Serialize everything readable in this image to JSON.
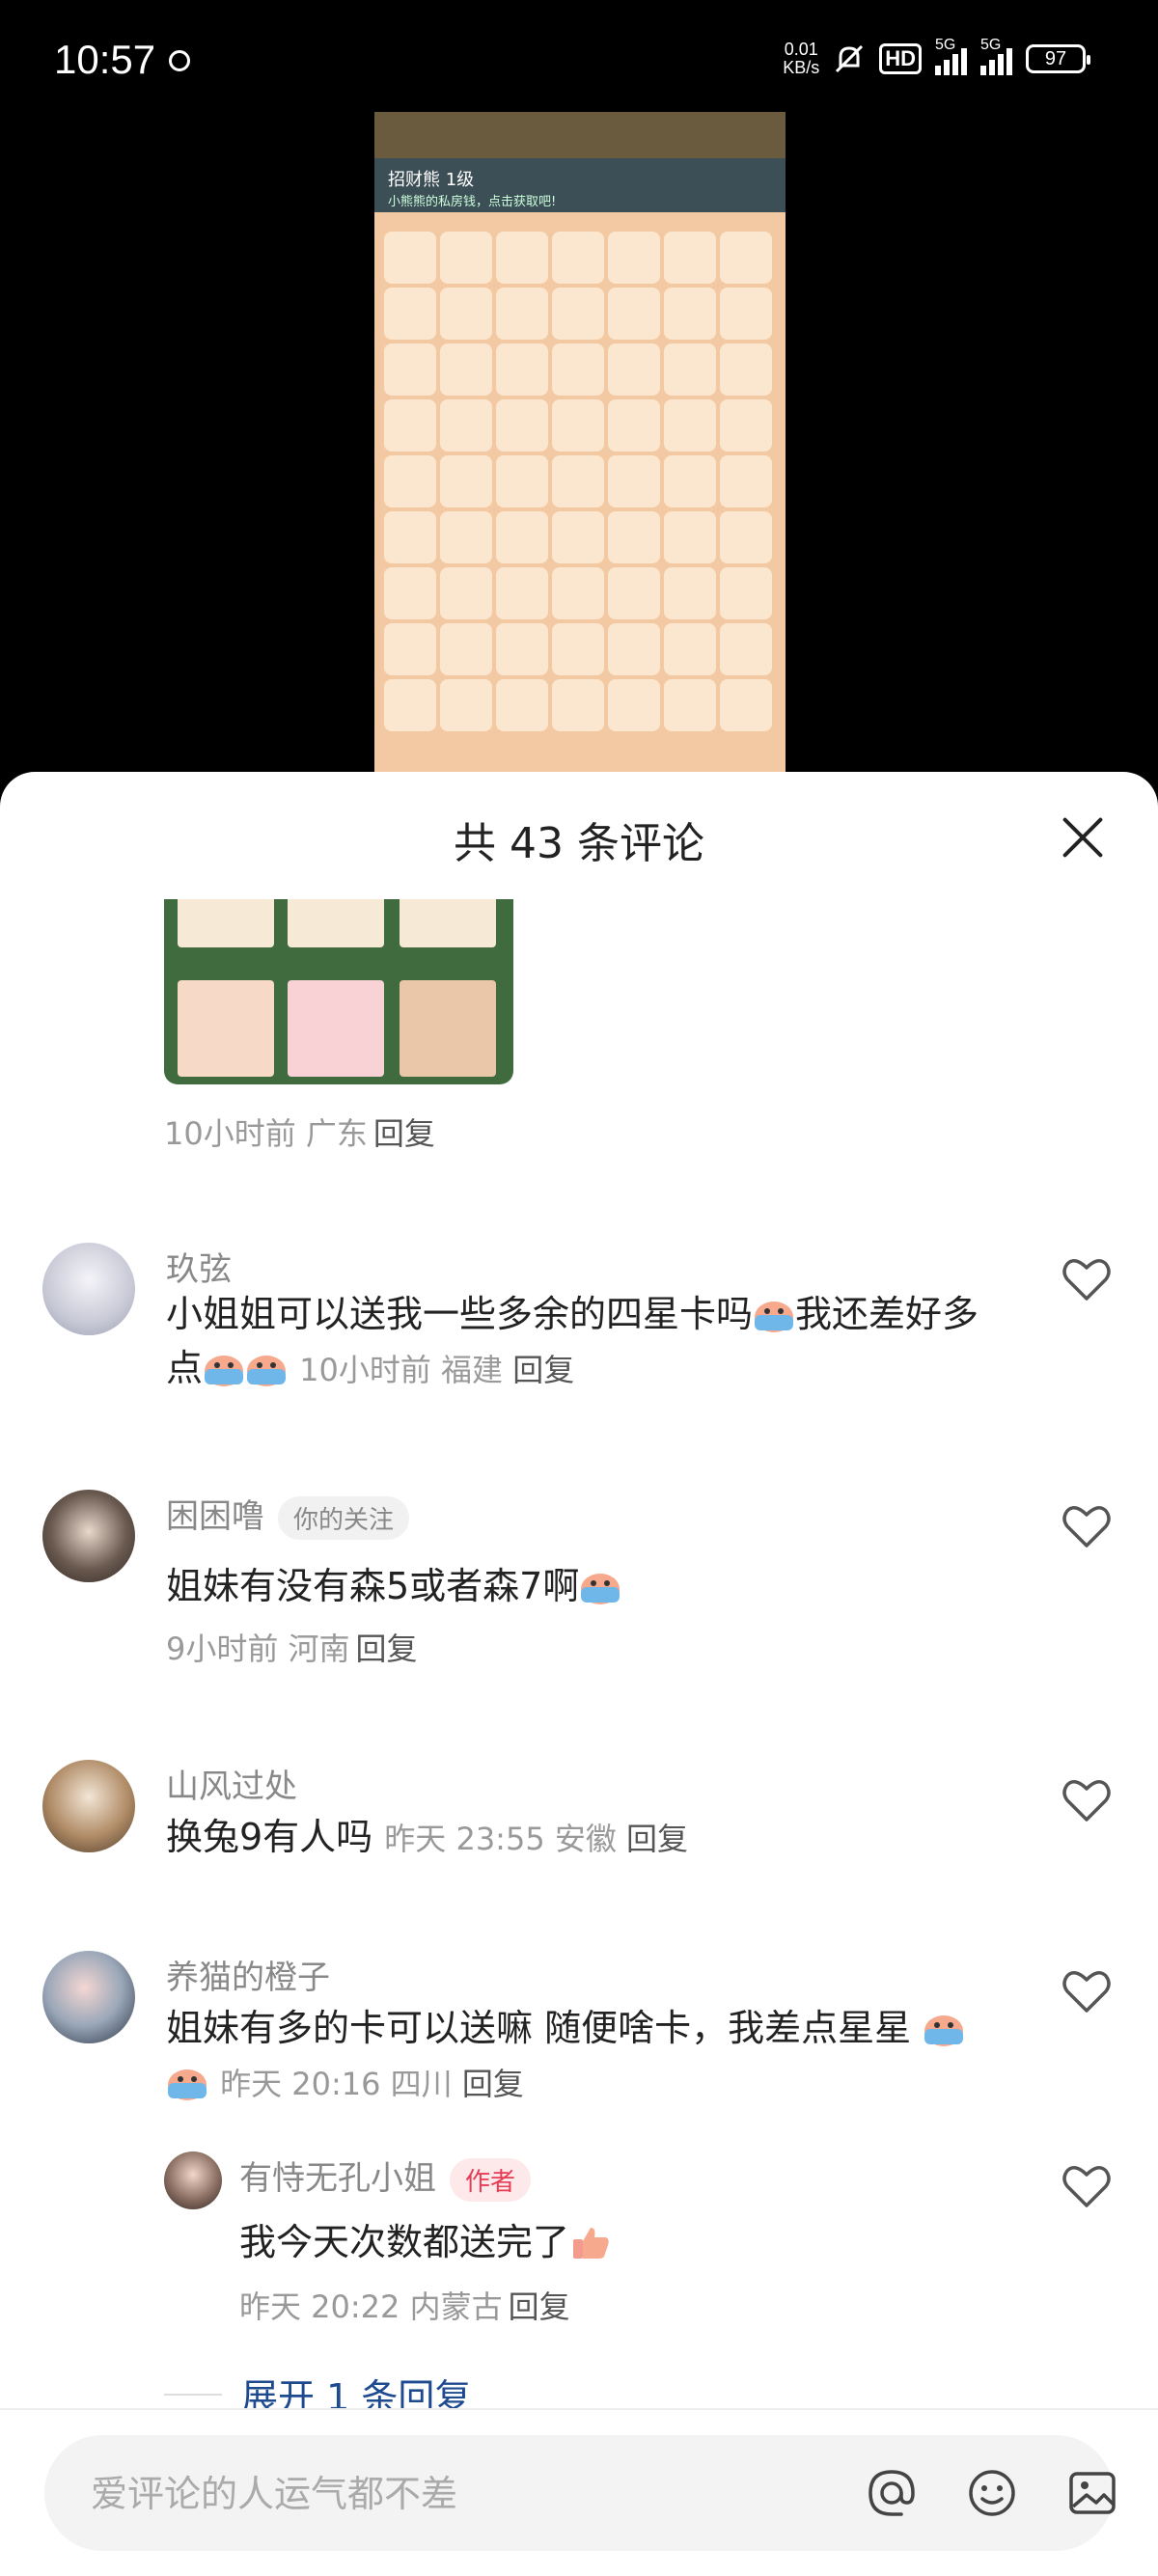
{
  "status_bar": {
    "time": "10:57",
    "net_speed_value": "0.01",
    "net_speed_unit": "KB/s",
    "hd_label": "HD",
    "signal1_label": "5G",
    "signal2_label": "5G",
    "battery": "97"
  },
  "video": {
    "banner_title": "招财熊      1级",
    "banner_sub": "小熊熊的私房钱，点击获取吧!"
  },
  "sheet": {
    "title": "共 43 条评论"
  },
  "comments": [
    {
      "meta": "10小时前  广东",
      "reply_label": "回复"
    },
    {
      "user": "玖弦",
      "text": "小姐姐可以送我一些多余的四星卡吗",
      "text2": "我还差好多点",
      "meta": "10小时前  福建",
      "reply_label": "回复"
    },
    {
      "user": "困困噜",
      "badge": "你的关注",
      "text": "姐妹有没有森5或者森7啊",
      "meta": "9小时前  河南",
      "reply_label": "回复"
    },
    {
      "user": "山风过处",
      "text": "换兔9有人吗",
      "meta": "昨天 23:55 安徽",
      "reply_label": "回复"
    },
    {
      "user": "养猫的橙子",
      "text": "姐妹有多的卡可以送嘛 随便啥卡，我差点星星",
      "meta": "昨天 20:16 四川",
      "reply_label": "回复"
    }
  ],
  "reply": {
    "user": "有恃无孔小姐",
    "badge": "作者",
    "text": "我今天次数都送完了",
    "meta": "昨天 20:22 内蒙古",
    "reply_label": "回复"
  },
  "expand_label": "展开 1 条回复",
  "input": {
    "placeholder": "爱评论的人运气都不差"
  },
  "colors": {
    "accent_link": "#1e4b8f",
    "author_badge": "#e63c54"
  }
}
